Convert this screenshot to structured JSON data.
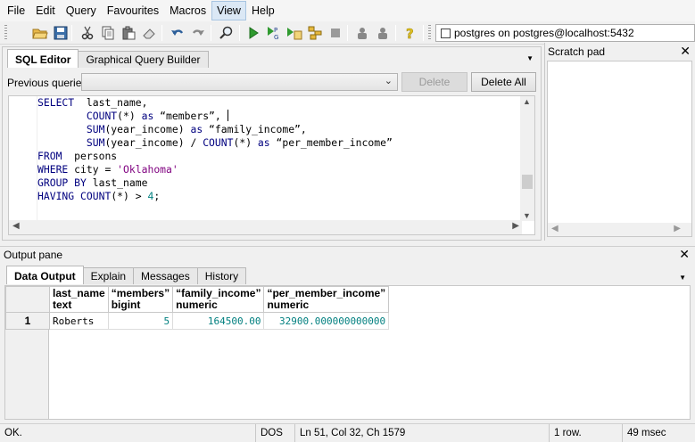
{
  "menu": {
    "items": [
      "File",
      "Edit",
      "Query",
      "Favourites",
      "Macros",
      "View",
      "Help"
    ],
    "active": "View"
  },
  "toolbar": {
    "icons": [
      "open-folder-icon",
      "save-icon",
      "cut-icon",
      "copy-icon",
      "paste-icon",
      "eraser-icon",
      "undo-icon",
      "redo-icon",
      "find-icon",
      "execute-icon",
      "execute-pgscript-icon",
      "execute-to-file-icon",
      "stop-icon",
      "explain-icon",
      "explain-analyze-icon",
      "help-icon"
    ],
    "connection": "postgres on postgres@localhost:5432"
  },
  "editor": {
    "tabs": [
      "SQL Editor",
      "Graphical Query Builder"
    ],
    "previous_queries_label": "Previous queries",
    "delete_label": "Delete",
    "delete_all_label": "Delete All"
  },
  "scratch": {
    "title": "Scratch pad"
  },
  "output": {
    "title": "Output pane",
    "tabs": [
      "Data Output",
      "Explain",
      "Messages",
      "History"
    ],
    "columns": [
      {
        "name": "last_name",
        "type": "text"
      },
      {
        "name": "“members”",
        "type": "bigint"
      },
      {
        "name": "“family_income”",
        "type": "numeric"
      },
      {
        "name": "“per_member_income”",
        "type": "numeric"
      }
    ],
    "rows": [
      {
        "n": "1",
        "cells": [
          "Roberts",
          "5",
          "164500.00",
          "32900.000000000000"
        ]
      }
    ]
  },
  "status": {
    "message": "OK.",
    "encoding": "DOS",
    "position": "Ln 51, Col 32, Ch 1579",
    "rows": "1 row.",
    "time": "49 msec"
  }
}
